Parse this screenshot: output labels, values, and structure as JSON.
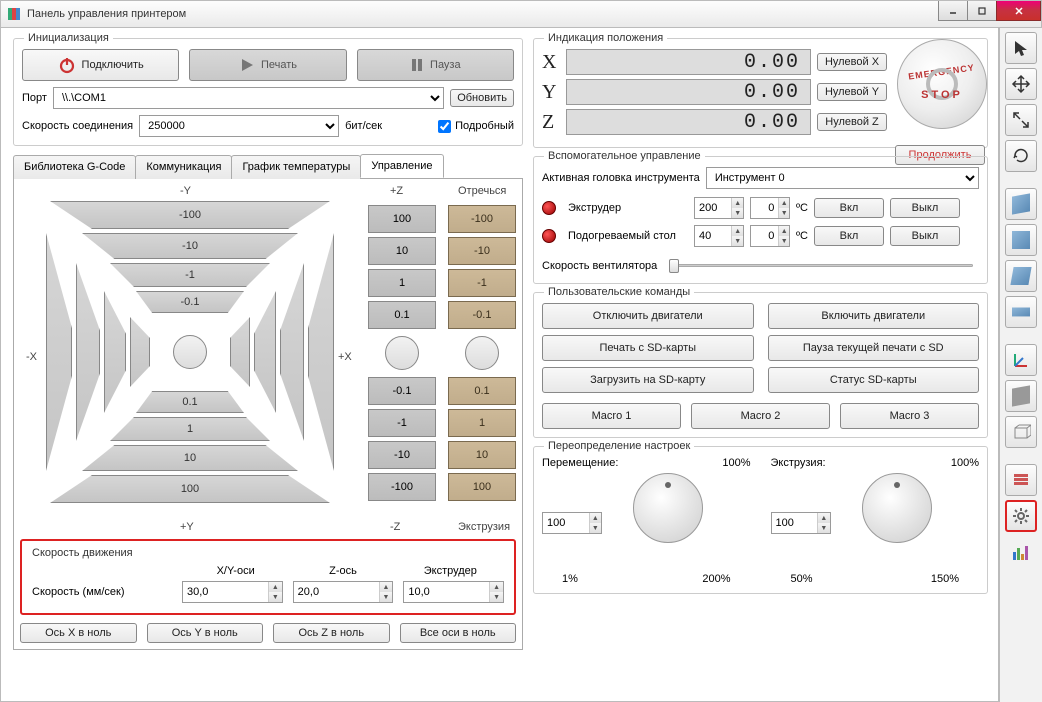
{
  "window": {
    "title": "Панель управления принтером"
  },
  "init": {
    "title": "Инициализация",
    "connect": "Подключить",
    "print": "Печать",
    "pause": "Пауза",
    "port_label": "Порт",
    "port_value": "\\\\.\\COM1",
    "refresh": "Обновить",
    "baud_label": "Скорость соединения",
    "baud_value": "250000",
    "baud_unit": "бит/сек",
    "verbose": "Подробный"
  },
  "tabs": {
    "gcode": "Библиотека G-Code",
    "comm": "Коммуникация",
    "temp": "График температуры",
    "control": "Управление"
  },
  "jog": {
    "ny": "-Y",
    "py": "+Y",
    "nx": "-X",
    "px": "+X",
    "pz": "+Z",
    "nz": "-Z",
    "retract": "Отречься",
    "extrude": "Экструзия",
    "v100n": "-100",
    "v10n": "-10",
    "v1n": "-1",
    "v01n": "-0.1",
    "v100": "100",
    "v10": "10",
    "v1": "1",
    "v01": "0.1",
    "z": [
      "100",
      "10",
      "1",
      "0.1",
      "-0.1",
      "-1",
      "-10",
      "-100"
    ],
    "e": [
      "-100",
      "-10",
      "-1",
      "-0.1",
      "0.1",
      "1",
      "10",
      "100"
    ]
  },
  "speed": {
    "title": "Скорость движения",
    "xy_h": "X/Y-оси",
    "z_h": "Z-ось",
    "e_h": "Экструдер",
    "label": "Скорость (мм/сек)",
    "xy": "30,0",
    "z": "20,0",
    "e": "10,0"
  },
  "homing": {
    "x": "Ось X в ноль",
    "y": "Ось Y в ноль",
    "z": "Ось Z в ноль",
    "all": "Все оси в ноль"
  },
  "pos": {
    "title": "Индикация положения",
    "x": "0.00",
    "y": "0.00",
    "z": "0.00",
    "zx": "Нулевой X",
    "zy": "Нулевой Y",
    "zz": "Нулевой Z",
    "continue": "Продолжить"
  },
  "aux": {
    "title": "Вспомогательное управление",
    "head_label": "Активная головка инструмента",
    "head_value": "Инструмент 0",
    "extruder": "Экструдер",
    "ext_temp": "200",
    "ext_set": "0",
    "bed": "Подогреваемый стол",
    "bed_temp": "40",
    "bed_set": "0",
    "unit": "ºC",
    "on": "Вкл",
    "off": "Выкл",
    "fan": "Скорость вентилятора"
  },
  "cmds": {
    "title": "Пользовательские команды",
    "moff": "Отключить двигатели",
    "mon": "Включить двигатели",
    "sdprint": "Печать с SD-карты",
    "sdpause": "Пауза текущей печати с SD",
    "sdupload": "Загрузить на SD-карту",
    "sdstat": "Статус SD-карты",
    "m1": "Macro 1",
    "m2": "Macro 2",
    "m3": "Macro 3"
  },
  "override": {
    "title": "Переопределение настроек",
    "move": "Перемещение:",
    "ext": "Экструзия:",
    "pct": "100%",
    "val": "100",
    "l1": "1%",
    "l200": "200%",
    "l50": "50%",
    "l150": "150%"
  }
}
